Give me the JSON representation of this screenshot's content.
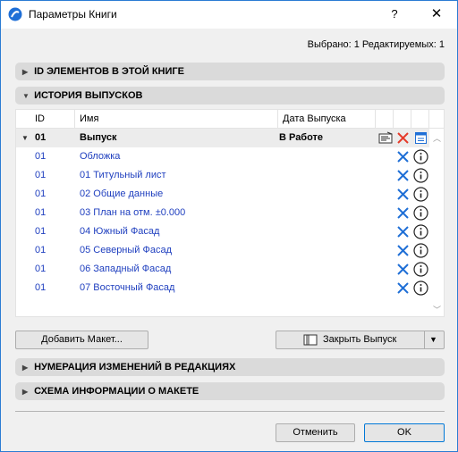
{
  "window": {
    "title": "Параметры Книги",
    "help_label": "?",
    "close_label": "✕"
  },
  "selection_info": "Выбрано: 1 Редактируемых: 1",
  "sections": {
    "id_elements": "ID ЭЛЕМЕНТОВ В ЭТОЙ КНИГЕ",
    "issue_history": "ИСТОРИЯ ВЫПУСКОВ",
    "revision_numbering": "НУМЕРАЦИЯ ИЗМЕНЕНИЙ В РЕДАКЦИЯХ",
    "layout_info_scheme": "СХЕМА ИНФОРМАЦИИ О МАКЕТЕ"
  },
  "table": {
    "columns": [
      "ID",
      "Имя",
      "Дата Выпуска"
    ],
    "group": {
      "id": "01",
      "name": "Выпуск",
      "date": "В Работе"
    },
    "rows": [
      {
        "id": "01",
        "name": "Обложка"
      },
      {
        "id": "01",
        "name": "01 Титульный лист"
      },
      {
        "id": "01",
        "name": "02 Общие данные"
      },
      {
        "id": "01",
        "name": "03 План на отм. ±0.000"
      },
      {
        "id": "01",
        "name": "04 Южный Фасад"
      },
      {
        "id": "01",
        "name": "05 Северный Фасад"
      },
      {
        "id": "01",
        "name": "06 Западный Фасад"
      },
      {
        "id": "01",
        "name": "07 Восточный Фасад"
      }
    ]
  },
  "buttons": {
    "add_layout": "Добавить Макет...",
    "close_issue": "Закрыть Выпуск",
    "cancel": "Отменить",
    "ok": "OK"
  },
  "colors": {
    "accent_blue": "#1f6fd6",
    "delete_red": "#e53a2a",
    "link_text": "#1f3fbf"
  }
}
